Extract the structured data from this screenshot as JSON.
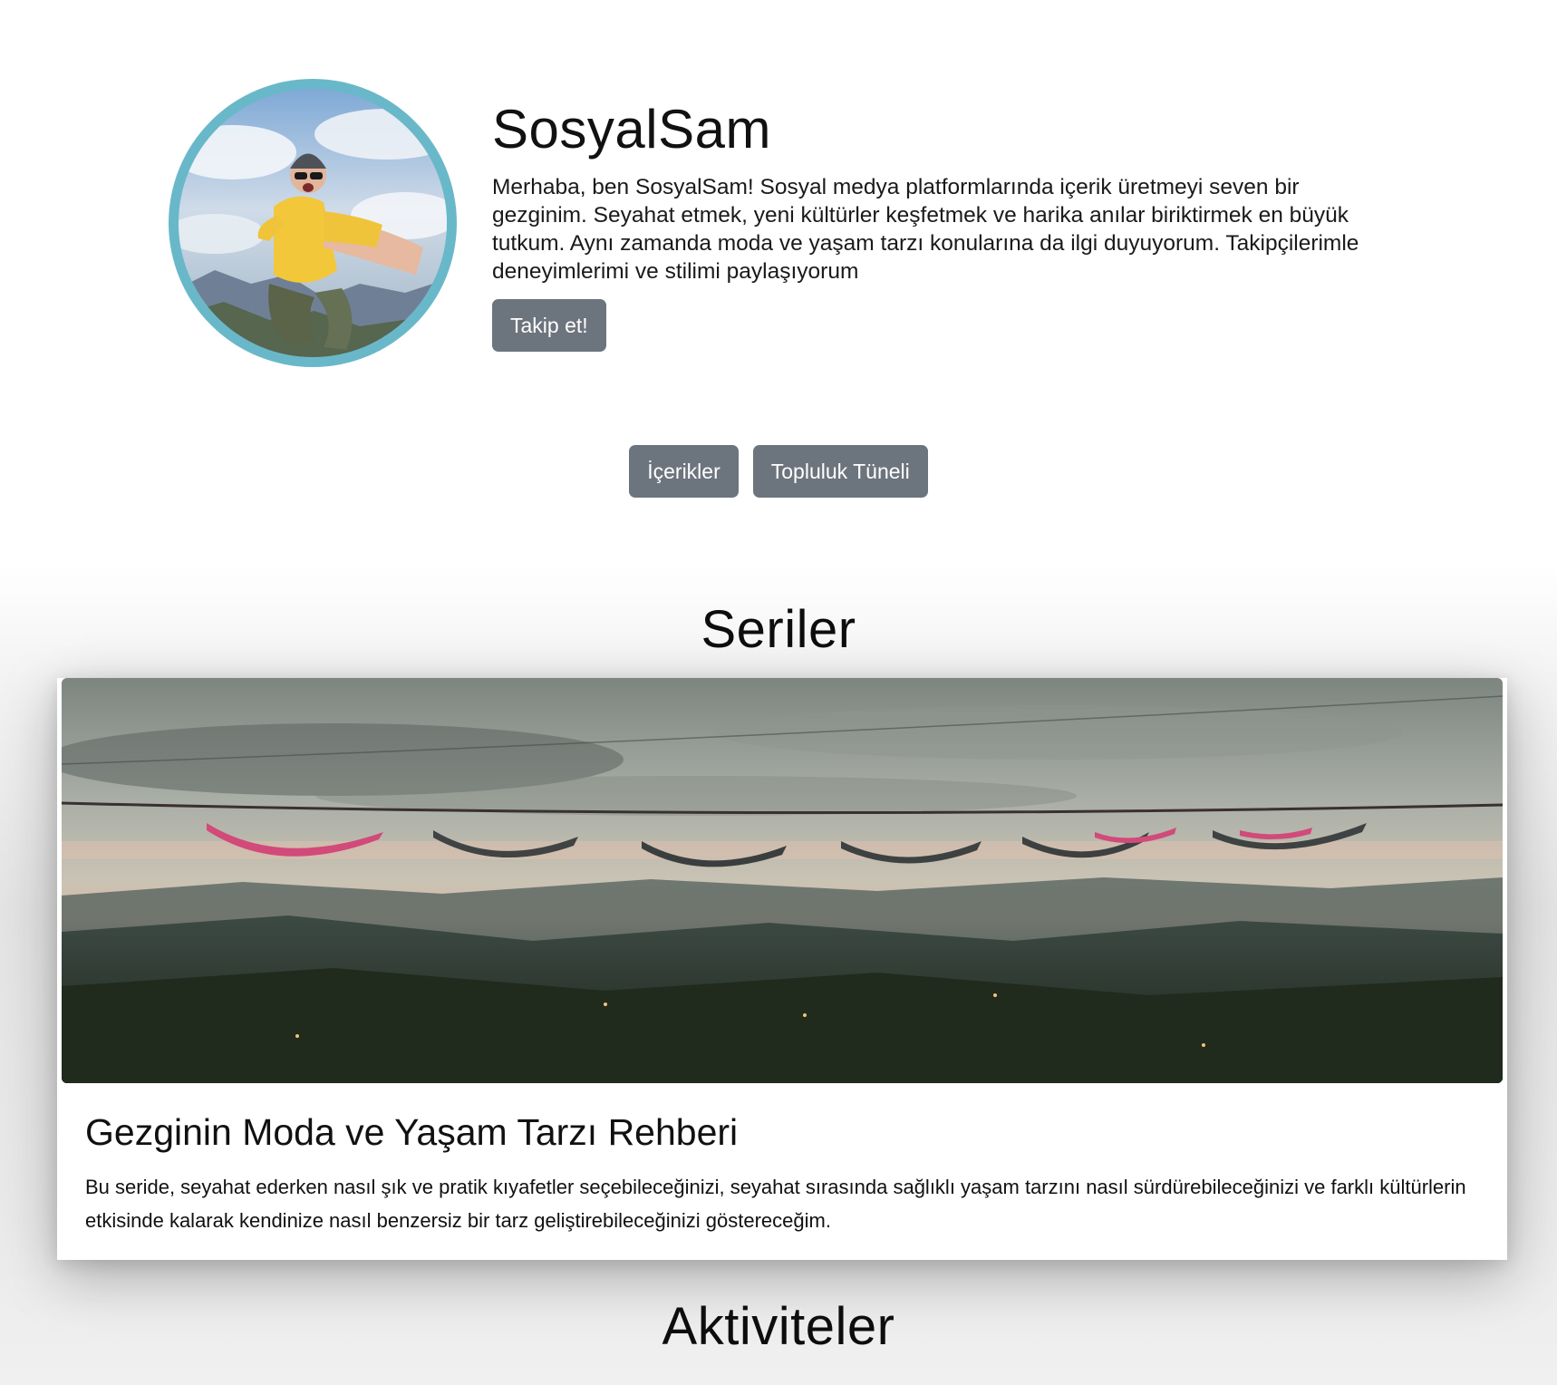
{
  "profile": {
    "avatar_icon": "profile-photo",
    "avatar_ring_color": "#69b8c9",
    "name": "SosyalSam",
    "bio": "Merhaba, ben SosyalSam! Sosyal medya platformlarında içerik üretmeyi seven bir gezginim. Seyahat etmek, yeni kültürler keşfetmek ve harika anılar biriktirmek en büyük tutkum. Aynı zamanda moda ve yaşam tarzı konularına da ilgi duyuyorum. Takipçilerimle deneyimlerimi ve stilimi paylaşıyorum",
    "follow_label": "Takip et!"
  },
  "tabs": [
    {
      "label": "İçerikler"
    },
    {
      "label": "Topluluk Tüneli"
    }
  ],
  "button_color": "#6c747d",
  "series_section": {
    "title": "Seriler",
    "items": [
      {
        "image_icon": "hammocks-landscape-photo",
        "title": "Gezginin Moda ve Yaşam Tarzı Rehberi",
        "description": "Bu seride, seyahat ederken nasıl şık ve pratik kıyafetler seçebileceğinizi, seyahat sırasında sağlıklı yaşam tarzını nasıl sürdürebileceğinizi ve farklı kültürlerin etkisinde kalarak kendinize nasıl benzersiz bir tarz geliştirebileceğinizi göstereceğim."
      }
    ]
  },
  "activities_section": {
    "title": "Aktiviteler"
  }
}
